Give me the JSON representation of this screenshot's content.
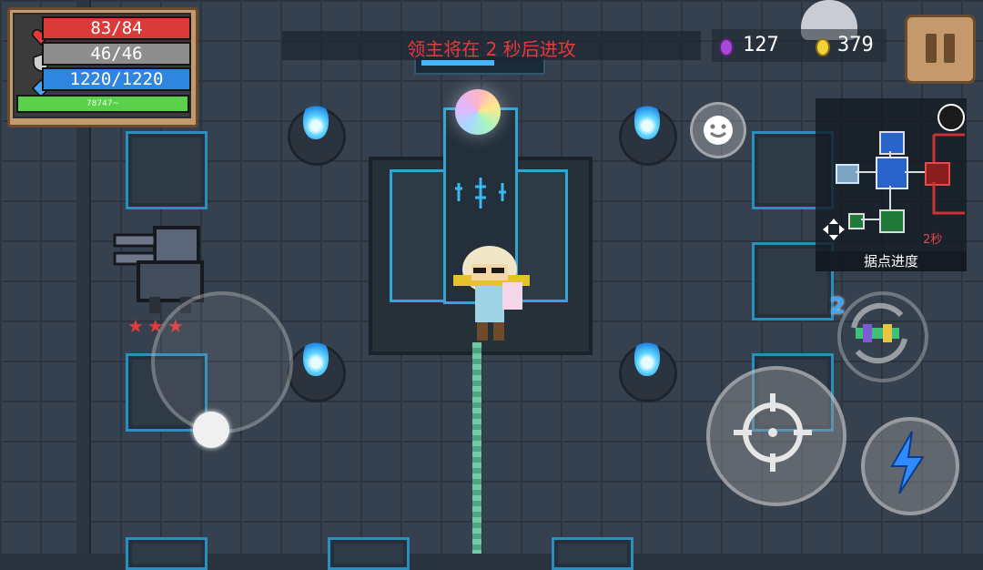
{
  "hud": {
    "health": "83/84",
    "armor": "46/46",
    "energy": "1220/1220",
    "xp_text": "78747~",
    "health_icon": "heart-icon",
    "armor_icon": "shield-icon",
    "energy_icon": "diamond-icon"
  },
  "banner": {
    "text": "领主将在 2 秒后进攻"
  },
  "currency": {
    "gems": "127",
    "coins": "379",
    "gem_color": "#a34bd6",
    "coin_color": "#f4d23c"
  },
  "minimap": {
    "label": "据点进度",
    "timer": "2秒"
  },
  "weapon": {
    "ammo": "2"
  },
  "colors": {
    "health": "#d93b3b",
    "armor": "#8e8e8e",
    "energy": "#2f86e0",
    "xp": "#5bd04a",
    "banner_text": "#e43a3a"
  },
  "icons": [
    "pause-icon",
    "emote-icon",
    "crosshair-icon",
    "lightning-icon",
    "swap-weapon-icon",
    "globe-icon",
    "move-icon"
  ]
}
